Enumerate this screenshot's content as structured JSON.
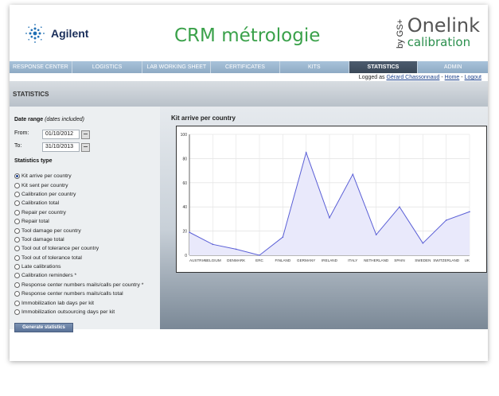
{
  "header": {
    "logo_text": "Agilent",
    "title": "CRM métrologie",
    "brand_by": "by GS+",
    "brand_main": "Onelink",
    "brand_sub": "calibration"
  },
  "nav": {
    "items": [
      {
        "label": "RESPONSE CENTER",
        "active": false
      },
      {
        "label": "LOGISTICS",
        "active": false
      },
      {
        "label": "LAB WORKING SHEET",
        "active": false
      },
      {
        "label": "CERTIFICATES",
        "active": false
      },
      {
        "label": "KITS",
        "active": false
      },
      {
        "label": "STATISTICS",
        "active": true
      },
      {
        "label": "ADMIN",
        "active": false
      }
    ]
  },
  "login": {
    "prefix": "Logged as",
    "user": "Gérard Chassonnaud",
    "sep1": "-",
    "home": "Home",
    "sep2": "-",
    "logout": "Logout"
  },
  "page": {
    "title": "STATISTICS"
  },
  "filters": {
    "date_range_label": "Date range",
    "date_range_note": "(dates included)",
    "from_label": "From:",
    "from_value": "01/10/2012",
    "to_label": "To:",
    "to_value": "31/10/2013",
    "stats_type_label": "Statistics type",
    "options": [
      {
        "label": "Kit arrive per country",
        "selected": true
      },
      {
        "label": "Kit sent per country",
        "selected": false
      },
      {
        "label": "Calibration per country",
        "selected": false
      },
      {
        "label": "Calibration total",
        "selected": false
      },
      {
        "label": "Repair per country",
        "selected": false
      },
      {
        "label": "Repair total",
        "selected": false
      },
      {
        "label": "Tool damage per country",
        "selected": false
      },
      {
        "label": "Tool damage total",
        "selected": false
      },
      {
        "label": "Tool out of tolerance per country",
        "selected": false
      },
      {
        "label": "Tool out of tolerance total",
        "selected": false
      },
      {
        "label": "Late calibrations",
        "selected": false
      },
      {
        "label": "Calibration reminders *",
        "selected": false
      },
      {
        "label": "Response center numbers mails/calls per country *",
        "selected": false
      },
      {
        "label": "Response center numbers mails/calls total",
        "selected": false
      },
      {
        "label": "Immobilization lab days per kit",
        "selected": false
      },
      {
        "label": "Immobilization outsourcing days per kit",
        "selected": false
      }
    ],
    "generate_label": "Generate statistics"
  },
  "chart_data": {
    "type": "area",
    "title": "Kit arrive per country",
    "categories": [
      "AUSTRIA",
      "BELGIUM",
      "DENMARK",
      "ERC",
      "FINLAND",
      "GERMANY",
      "IRELAND",
      "ITALY",
      "NETHERLAND",
      "SPAIN",
      "SWEDEN",
      "SWITZERLAND",
      "UK"
    ],
    "values": [
      19,
      9,
      5,
      0,
      15,
      85,
      31,
      67,
      17,
      40,
      10,
      29,
      36
    ],
    "ylim": [
      0,
      100
    ],
    "yticks": [
      0,
      20,
      40,
      60,
      80,
      100
    ],
    "grid": true,
    "colors": {
      "line": "#5a5fd6",
      "fill": "#e9e9fb"
    }
  }
}
